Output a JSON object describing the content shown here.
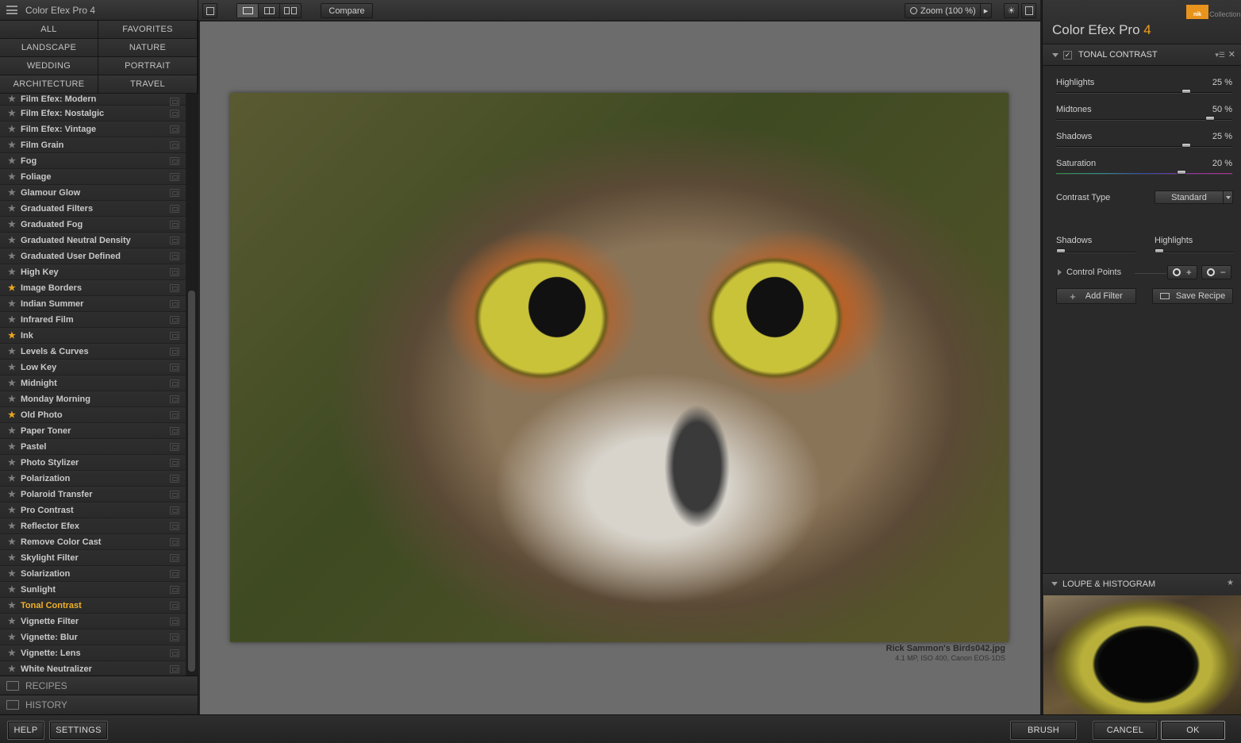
{
  "app": {
    "title": "Color Efex Pro 4"
  },
  "categories": [
    "ALL",
    "FAVORITES",
    "LANDSCAPE",
    "NATURE",
    "WEDDING",
    "PORTRAIT",
    "ARCHITECTURE",
    "TRAVEL"
  ],
  "filters": [
    {
      "label": "Film Efex: Modern",
      "favorite": false,
      "active": false
    },
    {
      "label": "Film Efex: Nostalgic",
      "favorite": false,
      "active": false
    },
    {
      "label": "Film Efex: Vintage",
      "favorite": false,
      "active": false
    },
    {
      "label": "Film Grain",
      "favorite": false,
      "active": false
    },
    {
      "label": "Fog",
      "favorite": false,
      "active": false
    },
    {
      "label": "Foliage",
      "favorite": false,
      "active": false
    },
    {
      "label": "Glamour Glow",
      "favorite": false,
      "active": false
    },
    {
      "label": "Graduated Filters",
      "favorite": false,
      "active": false
    },
    {
      "label": "Graduated Fog",
      "favorite": false,
      "active": false
    },
    {
      "label": "Graduated Neutral Density",
      "favorite": false,
      "active": false
    },
    {
      "label": "Graduated User Defined",
      "favorite": false,
      "active": false
    },
    {
      "label": "High Key",
      "favorite": false,
      "active": false
    },
    {
      "label": "Image Borders",
      "favorite": true,
      "active": false
    },
    {
      "label": "Indian Summer",
      "favorite": false,
      "active": false
    },
    {
      "label": "Infrared Film",
      "favorite": false,
      "active": false
    },
    {
      "label": "Ink",
      "favorite": true,
      "active": false
    },
    {
      "label": "Levels & Curves",
      "favorite": false,
      "active": false
    },
    {
      "label": "Low Key",
      "favorite": false,
      "active": false
    },
    {
      "label": "Midnight",
      "favorite": false,
      "active": false
    },
    {
      "label": "Monday Morning",
      "favorite": false,
      "active": false
    },
    {
      "label": "Old Photo",
      "favorite": true,
      "active": false
    },
    {
      "label": "Paper Toner",
      "favorite": false,
      "active": false
    },
    {
      "label": "Pastel",
      "favorite": false,
      "active": false
    },
    {
      "label": "Photo Stylizer",
      "favorite": false,
      "active": false
    },
    {
      "label": "Polarization",
      "favorite": false,
      "active": false
    },
    {
      "label": "Polaroid Transfer",
      "favorite": false,
      "active": false
    },
    {
      "label": "Pro Contrast",
      "favorite": false,
      "active": false
    },
    {
      "label": "Reflector Efex",
      "favorite": false,
      "active": false
    },
    {
      "label": "Remove Color Cast",
      "favorite": false,
      "active": false
    },
    {
      "label": "Skylight Filter",
      "favorite": false,
      "active": false
    },
    {
      "label": "Solarization",
      "favorite": false,
      "active": false
    },
    {
      "label": "Sunlight",
      "favorite": false,
      "active": false
    },
    {
      "label": "Tonal Contrast",
      "favorite": false,
      "active": true
    },
    {
      "label": "Vignette Filter",
      "favorite": false,
      "active": false
    },
    {
      "label": "Vignette: Blur",
      "favorite": false,
      "active": false
    },
    {
      "label": "Vignette: Lens",
      "favorite": false,
      "active": false
    },
    {
      "label": "White Neutralizer",
      "favorite": false,
      "active": false
    }
  ],
  "left_accordion": {
    "recipes": "RECIPES",
    "history": "HISTORY"
  },
  "toolbar": {
    "compare_label": "Compare",
    "zoom_label": "Zoom (100 %)",
    "light_icon": "☀",
    "zoom_arrow": "▶"
  },
  "image": {
    "filename": "Rick Sammon's Birds042.jpg",
    "meta": "4.1 MP, ISO 400, Canon EOS-1DS"
  },
  "right_panel": {
    "brand_logo": "nik",
    "brand_collection": "Collection",
    "product_name": "Color Efex Pro",
    "product_version": "4",
    "filter_name": "TONAL CONTRAST",
    "filter_check": "✓",
    "filter_options_icon": "▾☰",
    "filter_close_icon": "✕",
    "sliders": [
      {
        "label": "Highlights",
        "value": "25 %",
        "percent": 25
      },
      {
        "label": "Midtones",
        "value": "50 %",
        "percent": 50
      },
      {
        "label": "Shadows",
        "value": "25 %",
        "percent": 25
      },
      {
        "label": "Saturation",
        "value": "20 %",
        "percent": 20
      }
    ],
    "contrast_type_label": "Contrast Type",
    "contrast_type_value": "Standard",
    "mini_sliders": {
      "shadows": "Shadows",
      "highlights": "Highlights"
    },
    "control_points_label": "Control Points",
    "cp_add_icon": "+",
    "cp_remove_icon": "−",
    "add_filter_label": "Add Filter",
    "add_filter_icon": "+",
    "save_recipe_label": "Save Recipe",
    "loupe_label": "LOUPE & HISTOGRAM",
    "loupe_pin_icon": "★"
  },
  "bottom_bar": {
    "help": "HELP",
    "settings": "SETTINGS",
    "brush": "BRUSH",
    "cancel": "CANCEL",
    "ok": "OK"
  },
  "colors": {
    "accent": "#f0a020",
    "active_filter": "#f0b12a",
    "favorite_star": "#e8a524"
  }
}
